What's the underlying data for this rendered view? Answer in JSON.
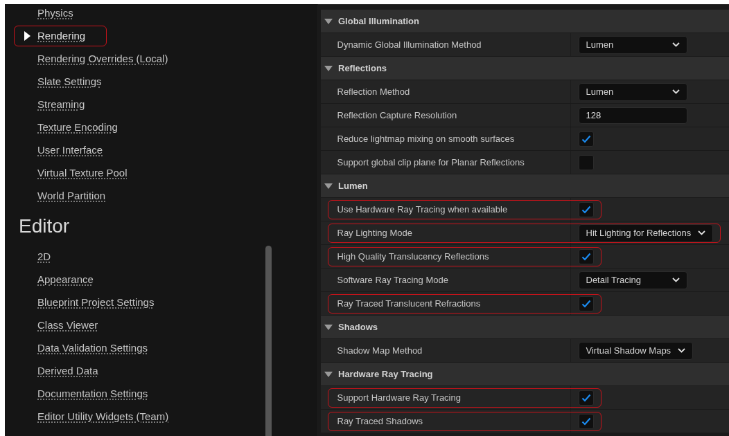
{
  "sidebar": {
    "items": [
      {
        "label": "Physics",
        "selected": false,
        "highlighted": false
      },
      {
        "label": "Rendering",
        "selected": true,
        "highlighted": true
      },
      {
        "label": "Rendering Overrides (Local)",
        "selected": false,
        "highlighted": false
      },
      {
        "label": "Slate Settings",
        "selected": false,
        "highlighted": false
      },
      {
        "label": "Streaming",
        "selected": false,
        "highlighted": false
      },
      {
        "label": "Texture Encoding",
        "selected": false,
        "highlighted": false
      },
      {
        "label": "User Interface",
        "selected": false,
        "highlighted": false
      },
      {
        "label": "Virtual Texture Pool",
        "selected": false,
        "highlighted": false
      },
      {
        "label": "World Partition",
        "selected": false,
        "highlighted": false
      }
    ],
    "section_title": "Editor",
    "section_items": [
      {
        "label": "2D",
        "selected": false,
        "highlighted": false
      },
      {
        "label": "Appearance",
        "selected": false,
        "highlighted": false
      },
      {
        "label": "Blueprint Project Settings",
        "selected": false,
        "highlighted": false
      },
      {
        "label": "Class Viewer",
        "selected": false,
        "highlighted": false
      },
      {
        "label": "Data Validation Settings",
        "selected": false,
        "highlighted": false
      },
      {
        "label": "Derived Data",
        "selected": false,
        "highlighted": false
      },
      {
        "label": "Documentation Settings",
        "selected": false,
        "highlighted": false
      },
      {
        "label": "Editor Utility Widgets (Team)",
        "selected": false,
        "highlighted": false
      }
    ]
  },
  "details": {
    "sections": [
      {
        "title": "Global Illumination",
        "expanded": true,
        "rows": [
          {
            "label": "Dynamic Global Illumination Method",
            "kind": "dropdown",
            "value": "Lumen",
            "highlighted": false
          }
        ]
      },
      {
        "title": "Reflections",
        "expanded": true,
        "rows": [
          {
            "label": "Reflection Method",
            "kind": "dropdown",
            "value": "Lumen",
            "highlighted": false
          },
          {
            "label": "Reflection Capture Resolution",
            "kind": "number",
            "value": "128",
            "highlighted": false
          },
          {
            "label": "Reduce lightmap mixing on smooth surfaces",
            "kind": "checkbox",
            "checked": true,
            "highlighted": false
          },
          {
            "label": "Support global clip plane for Planar Reflections",
            "kind": "checkbox",
            "checked": false,
            "highlighted": false
          }
        ]
      },
      {
        "title": "Lumen",
        "expanded": true,
        "rows": [
          {
            "label": "Use Hardware Ray Tracing when available",
            "kind": "checkbox",
            "checked": true,
            "highlighted": true
          },
          {
            "label": "Ray Lighting Mode",
            "kind": "dropdown",
            "value": "Hit Lighting for Reflections",
            "highlighted": true
          },
          {
            "label": "High Quality Translucency Reflections",
            "kind": "checkbox",
            "checked": true,
            "highlighted": true
          },
          {
            "label": "Software Ray Tracing Mode",
            "kind": "dropdown",
            "value": "Detail Tracing",
            "highlighted": false
          },
          {
            "label": "Ray Traced Translucent Refractions",
            "kind": "checkbox",
            "checked": true,
            "highlighted": true
          }
        ]
      },
      {
        "title": "Shadows",
        "expanded": true,
        "rows": [
          {
            "label": "Shadow Map Method",
            "kind": "dropdown",
            "value": "Virtual Shadow Maps",
            "highlighted": false
          }
        ]
      },
      {
        "title": "Hardware Ray Tracing",
        "expanded": true,
        "rows": [
          {
            "label": "Support Hardware Ray Tracing",
            "kind": "checkbox",
            "checked": true,
            "highlighted": true
          },
          {
            "label": "Ray Traced Shadows",
            "kind": "checkbox",
            "checked": true,
            "highlighted": true
          }
        ]
      }
    ]
  }
}
